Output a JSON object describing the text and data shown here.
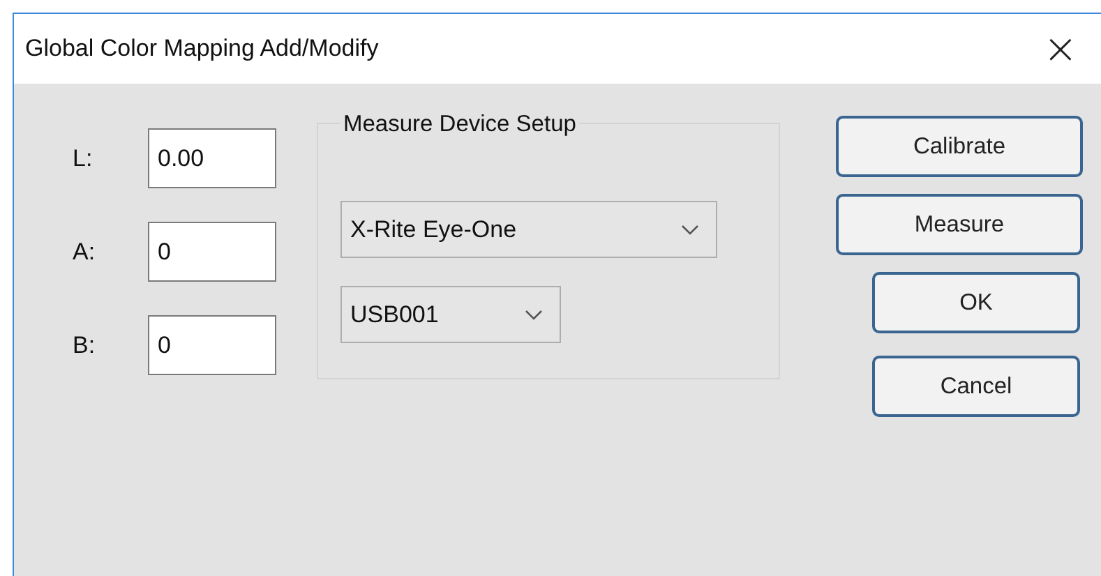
{
  "window": {
    "title": "Global Color Mapping Add/Modify",
    "close": "×"
  },
  "fields": [
    {
      "label": "L:",
      "value": "0.00"
    },
    {
      "label": "A:",
      "value": "0"
    },
    {
      "label": "B:",
      "value": "0"
    }
  ],
  "group": {
    "title": "Measure Device Setup",
    "dropdowns": [
      {
        "value": "X-Rite Eye-One",
        "kind": "wide"
      },
      {
        "value": "USB001",
        "kind": "narrow"
      }
    ]
  },
  "buttons": [
    {
      "label": "Calibrate",
      "kind": "wide"
    },
    {
      "label": "Measure",
      "kind": "wide"
    },
    {
      "label": "OK",
      "kind": "narrow"
    },
    {
      "label": "Cancel",
      "kind": "narrow"
    }
  ]
}
